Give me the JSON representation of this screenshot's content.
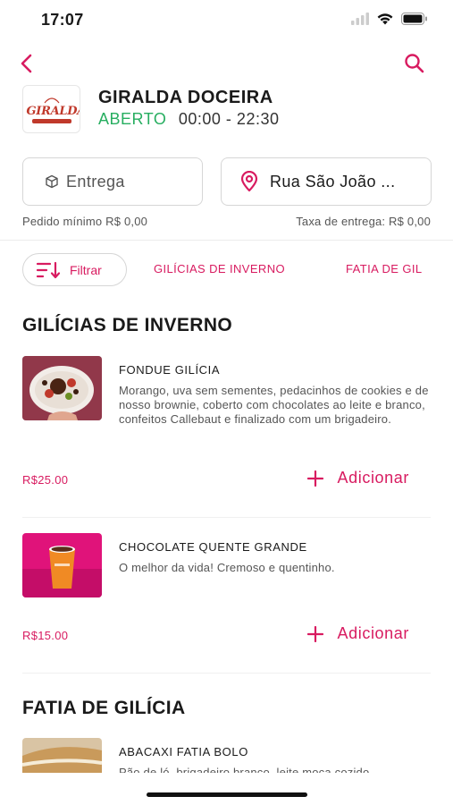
{
  "status_bar": {
    "time": "17:07"
  },
  "store": {
    "logo_text": "GIRALDA",
    "name": "GIRALDA DOCEIRA",
    "status": "ABERTO",
    "hours": "00:00 - 22:30"
  },
  "delivery": {
    "mode_label": "Entrega",
    "address_label": "Rua São João ...",
    "min_order": "Pedido mínimo R$ 0,00",
    "delivery_fee": "Taxa de entrega: R$ 0,00"
  },
  "filters": {
    "filter_label": "Filtrar",
    "categories": [
      "GILÍCIAS DE INVERNO",
      "FATIA DE GIL"
    ]
  },
  "sections": [
    {
      "title": "GILÍCIAS DE INVERNO",
      "products": [
        {
          "name": "FONDUE GILÍCIA",
          "description": "Morango, uva sem sementes, pedacinhos de cookies e de nosso brownie, coberto com chocolates ao leite e branco, confeitos Callebaut e finalizado com um brigadeiro.",
          "price": "R$25.00",
          "add_label": "Adicionar"
        },
        {
          "name": "CHOCOLATE QUENTE GRANDE",
          "description": "O melhor da vida! Cremoso e quentinho.",
          "price": "R$15.00",
          "add_label": "Adicionar"
        }
      ]
    },
    {
      "title": "FATIA DE GILÍCIA",
      "products": [
        {
          "name": "ABACAXI FATIA BOLO",
          "description": "Pão de ló, brigadeiro branco, leite moça cozido"
        }
      ]
    }
  ],
  "colors": {
    "accent": "#d81b60",
    "open": "#27ae60"
  }
}
